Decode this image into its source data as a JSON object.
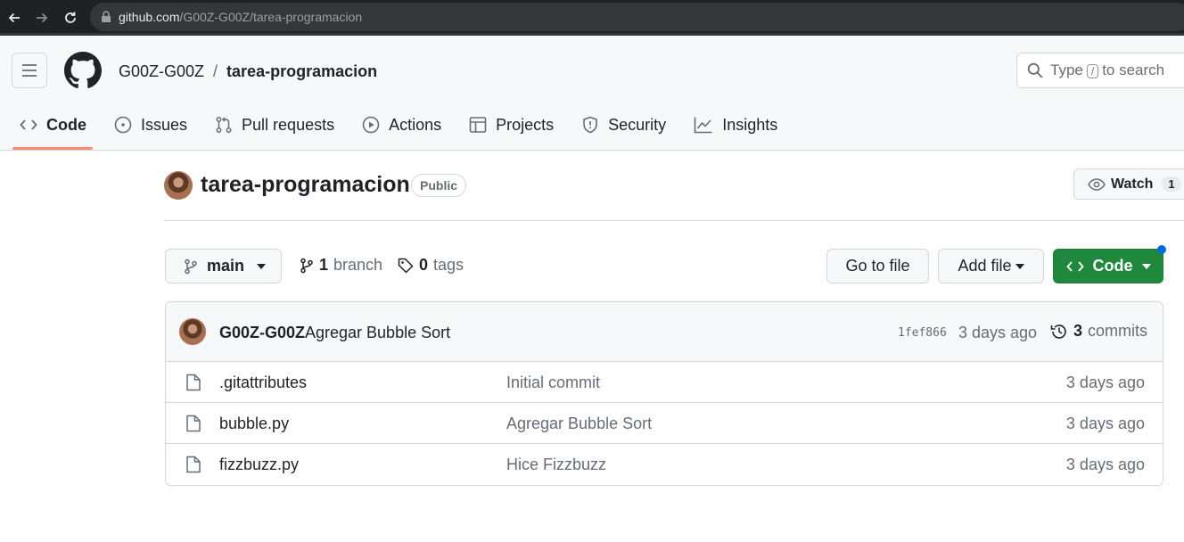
{
  "browser": {
    "url_host": "github.com",
    "url_path": "/G00Z-G00Z/tarea-programacion"
  },
  "header": {
    "owner": "G00Z-G00Z",
    "separator": "/",
    "repo": "tarea-programacion",
    "search": {
      "prefix": "Type",
      "key": "/",
      "suffix": "to search"
    }
  },
  "tabs": [
    {
      "label": "Code",
      "icon": "code-icon",
      "selected": true
    },
    {
      "label": "Issues",
      "icon": "issue-icon"
    },
    {
      "label": "Pull requests",
      "icon": "pull-request-icon"
    },
    {
      "label": "Actions",
      "icon": "play-icon"
    },
    {
      "label": "Projects",
      "icon": "table-icon"
    },
    {
      "label": "Security",
      "icon": "shield-icon"
    },
    {
      "label": "Insights",
      "icon": "graph-icon"
    }
  ],
  "repo": {
    "title": "tarea-programacion",
    "visibility": "Public",
    "watch_label": "Watch",
    "watch_count": "1"
  },
  "toolbar": {
    "branch_name": "main",
    "branch_count": "1",
    "branch_label": "branch",
    "tag_count": "0",
    "tag_label": "tags",
    "goto_file": "Go to file",
    "add_file": "Add file",
    "code": "Code"
  },
  "latest_commit": {
    "author": "G00Z-G00Z",
    "message": "Agregar Bubble Sort",
    "sha": "1fef866",
    "age": "3 days ago",
    "count": "3",
    "count_label": "commits"
  },
  "files": [
    {
      "name": ".gitattributes",
      "message": "Initial commit",
      "age": "3 days ago"
    },
    {
      "name": "bubble.py",
      "message": "Agregar Bubble Sort",
      "age": "3 days ago"
    },
    {
      "name": "fizzbuzz.py",
      "message": "Hice Fizzbuzz",
      "age": "3 days ago"
    }
  ],
  "colors": {
    "accent_green": "#1f883d",
    "tab_underline": "#fd8c73",
    "notification_blue": "#0969da"
  }
}
